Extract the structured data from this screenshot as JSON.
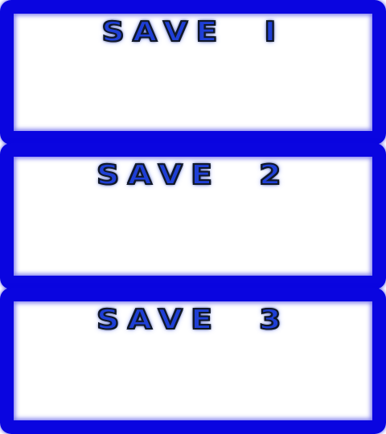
{
  "save_slots": [
    {
      "label": "SAVE  I"
    },
    {
      "label": "SAVE  2"
    },
    {
      "label": "SAVE  3"
    }
  ],
  "colors": {
    "frame": "#0a05e0",
    "slot_background": "#ffffff",
    "title_fill": "#1f3fd6",
    "title_outline": "#101828"
  }
}
